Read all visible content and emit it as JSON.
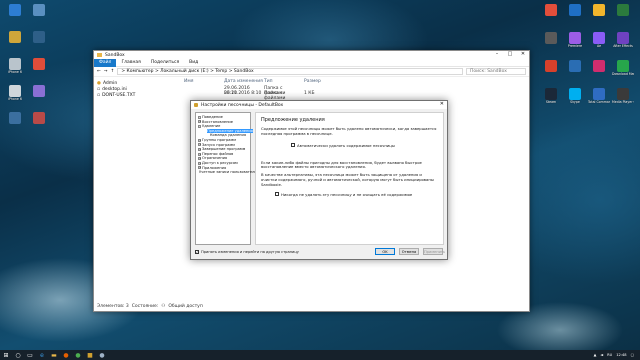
{
  "desktop": {
    "left_icons": [
      {
        "label": "",
        "color": "#2d7dd2"
      },
      {
        "label": "",
        "color": "#cfa63a"
      },
      {
        "label": "iPhone 6",
        "color": "#b9c4cc"
      },
      {
        "label": "iPhone 6",
        "color": "#cfd6db"
      },
      {
        "label": "",
        "color": "#3b6f9f"
      },
      {
        "label": "",
        "color": "#5a8fc0"
      },
      {
        "label": "",
        "color": "#2e5f88"
      },
      {
        "label": "",
        "color": "#e04d3a"
      },
      {
        "label": "",
        "color": "#8a6fd4"
      },
      {
        "label": "",
        "color": "#b94a48"
      }
    ],
    "right_icons": [
      {
        "label": "",
        "color": "#e24e3b"
      },
      {
        "label": "",
        "color": "#1f6fc4"
      },
      {
        "label": "",
        "color": "#f1b52c"
      },
      {
        "label": "",
        "color": "#2b7a3d"
      },
      {
        "label": "",
        "color": "#5a5a5a"
      },
      {
        "label": "Premiere",
        "color": "#9b5de5"
      },
      {
        "label": "Ae",
        "color": "#8a5cf6"
      },
      {
        "label": "After Effects",
        "color": "#6f42c1"
      },
      {
        "label": "",
        "color": "#d7402b"
      },
      {
        "label": "",
        "color": "#2a6db3"
      },
      {
        "label": "",
        "color": "#d02d6e"
      },
      {
        "label": "Download Master",
        "color": "#27a64b"
      },
      {
        "label": "Steam",
        "color": "#1b2838"
      },
      {
        "label": "Skype",
        "color": "#00aff0"
      },
      {
        "label": "Total Commander",
        "color": "#2f6cc2"
      },
      {
        "label": "Media Player Classic",
        "color": "#3a3a3a"
      }
    ]
  },
  "explorer": {
    "title": "SandBox",
    "ribbon": {
      "file_tab": "Файл",
      "tabs": [
        "Главная",
        "Поделиться",
        "Вид"
      ]
    },
    "address": {
      "path": "> Компьютер > Локальный диск (E:) > Temp > SandBox",
      "search_placeholder": "Поиск: SandBox"
    },
    "nav": [
      "Admin",
      "desktop.ini",
      "DONT-USE.TXT"
    ],
    "columns": [
      "Имя",
      "Дата изменения",
      "Тип",
      "Размер"
    ],
    "rows": [
      [
        "",
        "29.06.2016 23:20",
        "Папка с файлами",
        ""
      ],
      [
        "",
        "06.11.2016 8:10",
        "Папка с файлами",
        "1 КБ"
      ]
    ],
    "status": {
      "count": "Элементов: 3",
      "state": "Состояние:",
      "shared": "Общий доступ"
    }
  },
  "dialog": {
    "title": "Настройки песочницы - DefaultBox",
    "tree": [
      {
        "label": "Поведение",
        "level": 0,
        "expander": "-"
      },
      {
        "label": "Восстановление",
        "level": 0,
        "expander": "+"
      },
      {
        "label": "Удаление",
        "level": 0,
        "expander": "-"
      },
      {
        "label": "Предложение удаления",
        "level": 1,
        "expander": "",
        "selected": true
      },
      {
        "label": "Команда удаления",
        "level": 1,
        "expander": ""
      },
      {
        "label": "Группы программ",
        "level": 0,
        "expander": "+"
      },
      {
        "label": "Запуск программ",
        "level": 0,
        "expander": "+"
      },
      {
        "label": "Завершение программ",
        "level": 0,
        "expander": "+"
      },
      {
        "label": "Перенос файлов",
        "level": 0,
        "expander": "+"
      },
      {
        "label": "Ограничения",
        "level": 0,
        "expander": "+"
      },
      {
        "label": "Доступ к ресурсам",
        "level": 0,
        "expander": "+"
      },
      {
        "label": "Приложения",
        "level": 0,
        "expander": "+"
      },
      {
        "label": "Учетные записи пользователей",
        "level": 0,
        "expander": ""
      }
    ],
    "panel": {
      "heading": "Предложение удаления",
      "text1": "Содержимое этой песочницы может быть удалено автоматически, когда завершается последняя программа в песочнице.",
      "checkbox1": "Автоматически удалять содержимое песочницы",
      "text2": "Если какие-либо файлы пригодны для восстановления, будет вызвано быстрое восстановление вместо автоматического удаления.",
      "text3": "В качестве альтернативы, эта песочница может быть защищена от удаления и очистки содержимого, ручной и автоматической, которую могут быть инициированы Sandboxie.",
      "checkbox2": "Никогда не удалять эту песочницу и не очищать её содержимое"
    },
    "apply_checkbox": "Принять изменения и перейти на другую страницу",
    "buttons": {
      "ok": "OK",
      "cancel": "Отмена",
      "apply": "Применить"
    }
  },
  "taskbar": {
    "items": [
      "start",
      "search",
      "task-view",
      "edge",
      "explorer",
      "firefox",
      "chrome",
      "sandboxie",
      "steam"
    ],
    "time": "12:48",
    "lang": "RU"
  }
}
